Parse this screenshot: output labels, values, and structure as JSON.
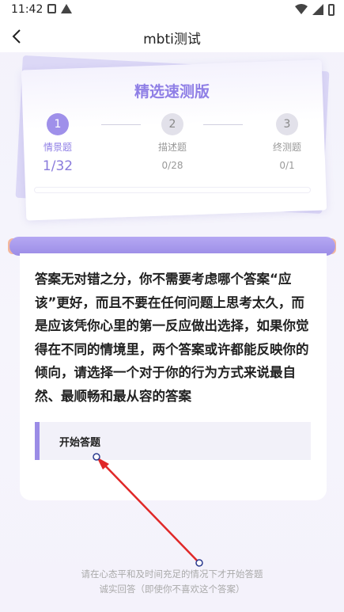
{
  "status_bar": {
    "time": "11:42"
  },
  "header": {
    "title": "mbti测试"
  },
  "progress_card": {
    "title": "精选速测版",
    "steps": [
      {
        "number": "1",
        "label": "情景题",
        "count": "1/32",
        "state": "active"
      },
      {
        "number": "2",
        "label": "描述题",
        "count": "0/28",
        "state": "inactive"
      },
      {
        "number": "3",
        "label": "终测题",
        "count": "0/1",
        "state": "inactive"
      }
    ]
  },
  "main": {
    "instructions": "答案无对错之分，你不需要考虑哪个答案“应该”更好，而且不要在任何问题上思考太久，而是应该凭你心里的第一反应做出选择，如果你觉得在不同的情境里，两个答案或许都能反映你的倾向，请选择一个对于你的行为方式来说最自然、最顺畅和最从容的答案",
    "start_button_label": "开始答题"
  },
  "footer": {
    "line1": "请在心态平和及时间充足的情况下才开始答题",
    "line2": "诚实回答（即使你不喜欢这个答案）"
  },
  "colors": {
    "accent": "#9b8ce6",
    "annotation_arrow": "#e02828"
  }
}
